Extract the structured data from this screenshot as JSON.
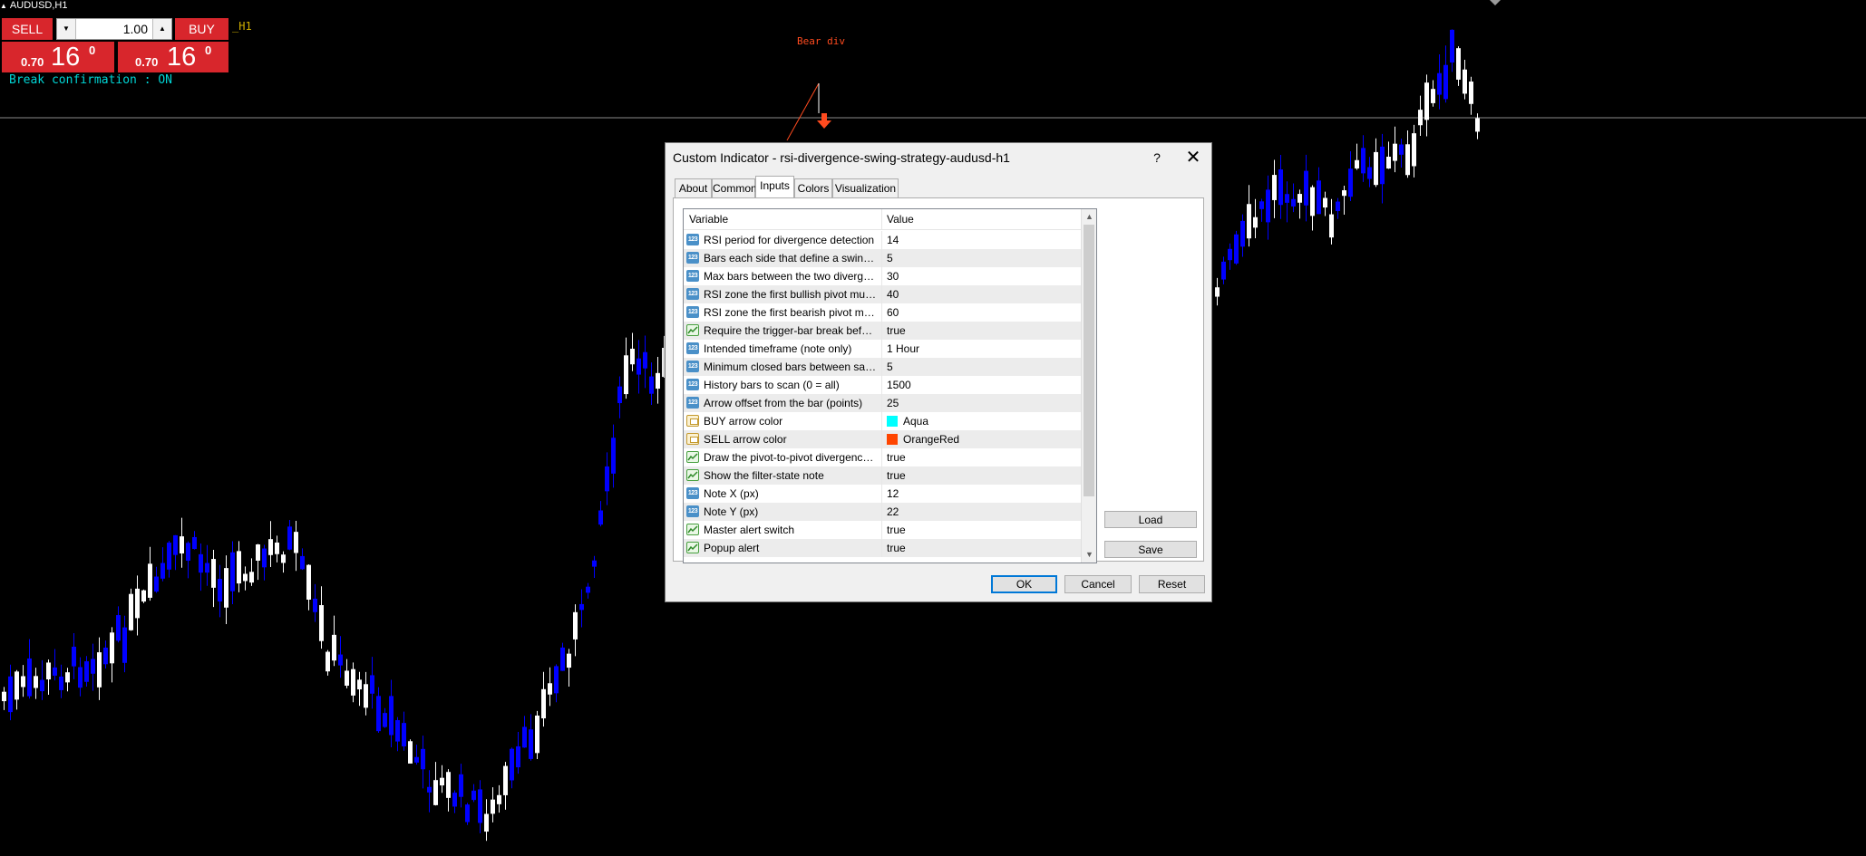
{
  "chart": {
    "symbol": "AUDUSD,H1",
    "timeframe_label": "_H1",
    "note": "Break confirmation : ON",
    "signal_label": "Bear div"
  },
  "trade_panel": {
    "sell_label": "SELL",
    "buy_label": "BUY",
    "lot_value": "1.00",
    "sell_price_prefix": "0.70",
    "sell_price_big": "16",
    "sell_price_sup": "0",
    "buy_price_prefix": "0.70",
    "buy_price_big": "16",
    "buy_price_sup": "0"
  },
  "dialog": {
    "title": "Custom Indicator - rsi-divergence-swing-strategy-audusd-h1",
    "help": "?",
    "close": "✕",
    "tabs": [
      "About",
      "Common",
      "Inputs",
      "Colors",
      "Visualization"
    ],
    "active_tab": "Inputs",
    "columns": {
      "variable": "Variable",
      "value": "Value"
    },
    "inputs": [
      {
        "type": "num",
        "name": "RSI period for divergence detection",
        "value": "14"
      },
      {
        "type": "num",
        "name": "Bars each side that define a swing pivot",
        "value": "5"
      },
      {
        "type": "num",
        "name": "Max bars between the two divergence ...",
        "value": "30"
      },
      {
        "type": "num",
        "name": "RSI zone the first bullish pivot must co...",
        "value": "40"
      },
      {
        "type": "num",
        "name": "RSI zone the first bearish pivot must co...",
        "value": "60"
      },
      {
        "type": "bool",
        "name": "Require the trigger-bar break before th...",
        "value": "true"
      },
      {
        "type": "num",
        "name": "Intended timeframe (note only)",
        "value": "1 Hour"
      },
      {
        "type": "num",
        "name": "Minimum closed bars between same-si...",
        "value": "5"
      },
      {
        "type": "num",
        "name": "History bars to scan (0 = all)",
        "value": "1500"
      },
      {
        "type": "num",
        "name": "Arrow offset from the bar (points)",
        "value": "25"
      },
      {
        "type": "color",
        "name": "BUY arrow color",
        "value": "Aqua",
        "swatch": "#00ffff"
      },
      {
        "type": "color",
        "name": "SELL arrow color",
        "value": "OrangeRed",
        "swatch": "#ff4500"
      },
      {
        "type": "bool",
        "name": "Draw the pivot-to-pivot divergence lines",
        "value": "true"
      },
      {
        "type": "bool",
        "name": "Show the filter-state note",
        "value": "true"
      },
      {
        "type": "num",
        "name": "Note X (px)",
        "value": "12"
      },
      {
        "type": "num",
        "name": "Note Y (px)",
        "value": "22"
      },
      {
        "type": "bool",
        "name": "Master alert switch",
        "value": "true"
      },
      {
        "type": "bool",
        "name": "Popup alert",
        "value": "true"
      }
    ],
    "num_icon_text": "123",
    "load_label": "Load",
    "save_label": "Save",
    "ok_label": "OK",
    "cancel_label": "Cancel",
    "reset_label": "Reset"
  },
  "colors": {
    "background": "#000000",
    "bull_candle": "#ffffff",
    "bear_candle": "#0000ff",
    "trade_red": "#d8262c",
    "note_cyan": "#00d6d6",
    "signal_orange": "#ff4b1f"
  }
}
